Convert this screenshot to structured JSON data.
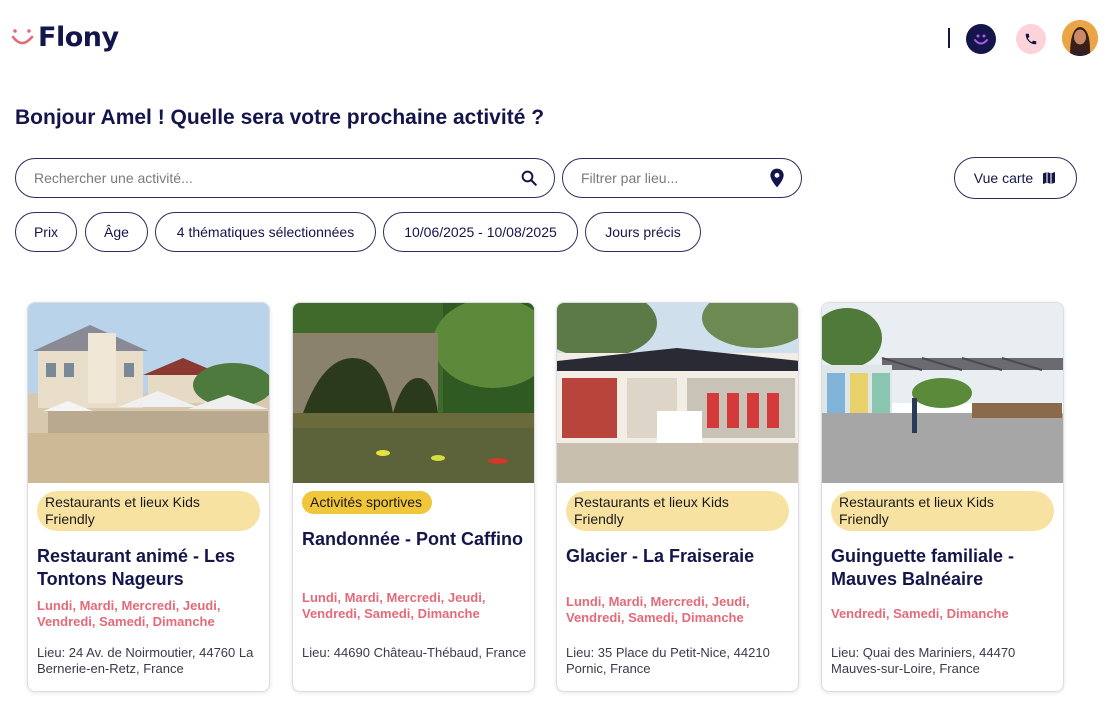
{
  "app": {
    "name": "Flony"
  },
  "header": {
    "user_avatar": "avatar",
    "icons": [
      "smile-icon",
      "phone-icon"
    ]
  },
  "greeting": "Bonjour Amel ! Quelle sera votre prochaine activité ?",
  "search": {
    "placeholder": "Rechercher une activité..."
  },
  "place_filter": {
    "placeholder": "Filtrer par lieu..."
  },
  "map_button": {
    "label": "Vue carte"
  },
  "filters": [
    {
      "label": "Prix"
    },
    {
      "label": "Âge"
    },
    {
      "label": "4 thématiques sélectionnées"
    },
    {
      "label": "10/06/2025 - 10/08/2025"
    },
    {
      "label": "Jours précis"
    }
  ],
  "colors": {
    "brand": "#14154a",
    "accent": "#e46a78",
    "tag_light": "#f8e2a2",
    "tag_strong": "#f0c63a"
  },
  "cards": [
    {
      "tag": "Restaurants et lieux Kids Friendly",
      "title": "Restaurant animé - Les Tontons Nageurs",
      "days": "Lundi, Mardi, Mercredi, Jeudi, Vendredi, Samedi, Dimanche",
      "location": "Lieu: 24 Av. de Noirmoutier, 44760 La Bernerie-en-Retz, France"
    },
    {
      "tag": "Activités sportives",
      "title": "Randonnée - Pont Caffino",
      "days": "Lundi, Mardi, Mercredi, Jeudi, Vendredi, Samedi, Dimanche",
      "location": "Lieu: 44690 Château-Thébaud, France"
    },
    {
      "tag": "Restaurants et lieux Kids Friendly",
      "title": "Glacier - La Fraiseraie",
      "days": "Lundi, Mardi, Mercredi, Jeudi, Vendredi, Samedi, Dimanche",
      "location": "Lieu: 35 Place du Petit-Nice, 44210 Pornic, France"
    },
    {
      "tag": "Restaurants et lieux Kids Friendly",
      "title": "Guinguette familiale - Mauves Balnéaire",
      "days": "Vendredi, Samedi, Dimanche",
      "location": "Lieu: Quai des Mariniers, 44470 Mauves-sur-Loire, France"
    }
  ]
}
